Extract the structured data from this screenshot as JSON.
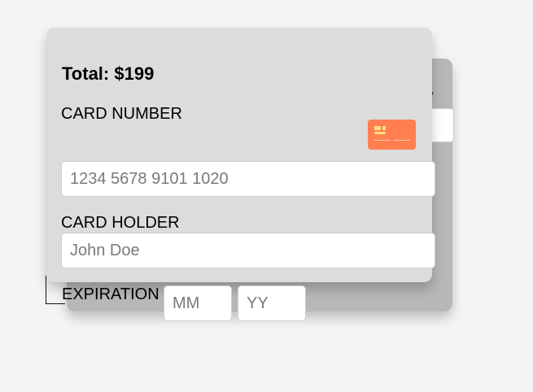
{
  "back_card": {
    "label": "V"
  },
  "form": {
    "total_text": "Total: $199",
    "card_number": {
      "label": "CARD NUMBER",
      "placeholder": "1234 5678 9101 1020",
      "value": ""
    },
    "card_holder": {
      "label": "CARD HOLDER",
      "placeholder": "John Doe",
      "value": ""
    },
    "expiration": {
      "label": "EXPIRATION",
      "month_placeholder": "MM",
      "year_placeholder": "YY"
    }
  },
  "icons": {
    "card_icon": "credit-card-icon"
  },
  "colors": {
    "page_bg": "#f4f4f4",
    "front_card_bg": "#dcdcdc",
    "back_card_bg": "#b7b7b7",
    "card_icon_bg": "#ff7f50"
  }
}
